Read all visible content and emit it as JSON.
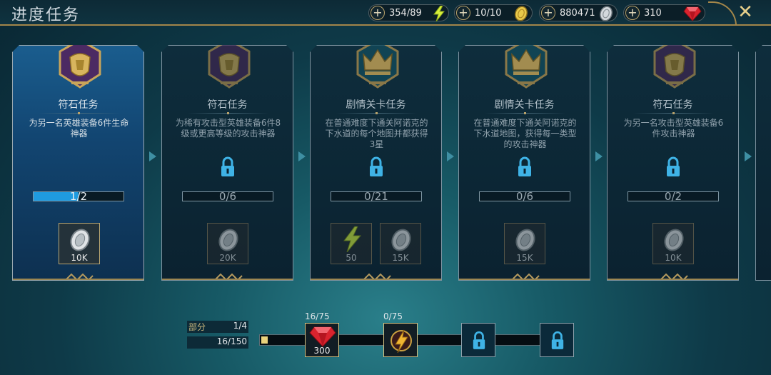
{
  "title": "进度任务",
  "currencies": [
    {
      "value": "354/89",
      "icon": "lightning-icon"
    },
    {
      "value": "10/10",
      "icon": "gold-coin-icon"
    },
    {
      "value": "880471",
      "icon": "silver-coin-icon"
    },
    {
      "value": "310",
      "icon": "ruby-gem-icon"
    }
  ],
  "cards": [
    {
      "title": "符石任务",
      "desc": "为另一名英雄装备6件生命神器",
      "progress": "1/2",
      "progress_fraction": 0.5,
      "locked": false,
      "emblem": "armor-emblem-icon",
      "rewards": [
        {
          "icon": "silver-coin-icon",
          "value": "10K"
        }
      ]
    },
    {
      "title": "符石任务",
      "desc": "为稀有攻击型英雄装备6件8级或更高等级的攻击神器",
      "progress": "0/6",
      "progress_fraction": 0,
      "locked": true,
      "emblem": "armor-emblem-icon",
      "rewards": [
        {
          "icon": "silver-coin-icon",
          "value": "20K"
        }
      ]
    },
    {
      "title": "剧情关卡任务",
      "desc": "在普通难度下通关阿诺克的下水道的每个地图并都获得3星",
      "progress": "0/21",
      "progress_fraction": 0,
      "locked": true,
      "emblem": "crown-emblem-icon",
      "rewards": [
        {
          "icon": "lightning-icon",
          "value": "50"
        },
        {
          "icon": "silver-coin-icon",
          "value": "15K"
        }
      ]
    },
    {
      "title": "剧情关卡任务",
      "desc": "在普通难度下通关阿诺克的下水道地图，获得每一类型的攻击神器",
      "progress": "0/6",
      "progress_fraction": 0,
      "locked": true,
      "emblem": "crown-emblem-icon",
      "rewards": [
        {
          "icon": "silver-coin-icon",
          "value": "15K"
        }
      ]
    },
    {
      "title": "符石任务",
      "desc": "为另一名攻击型英雄装备6件攻击神器",
      "progress": "0/2",
      "progress_fraction": 0,
      "locked": true,
      "emblem": "armor-emblem-icon",
      "rewards": [
        {
          "icon": "silver-coin-icon",
          "value": "10K"
        }
      ]
    }
  ],
  "part": {
    "label": "部分",
    "count": "1/4",
    "points": "16/150",
    "points_fraction": 0.107
  },
  "milestones": [
    {
      "label": "16/75",
      "value": "300",
      "icon": "ruby-gem-icon",
      "locked": false
    },
    {
      "label": "0/75",
      "value": "",
      "icon": "artifact-icon",
      "locked": false
    },
    {
      "label": "",
      "value": "",
      "icon": "lock-icon",
      "locked": true
    },
    {
      "label": "",
      "value": "",
      "icon": "lock-icon",
      "locked": true
    }
  ],
  "colors": {
    "accent_gold": "#a3864a",
    "progress_blue": "#1f9be0",
    "lock_blue": "#3fb3e6"
  }
}
